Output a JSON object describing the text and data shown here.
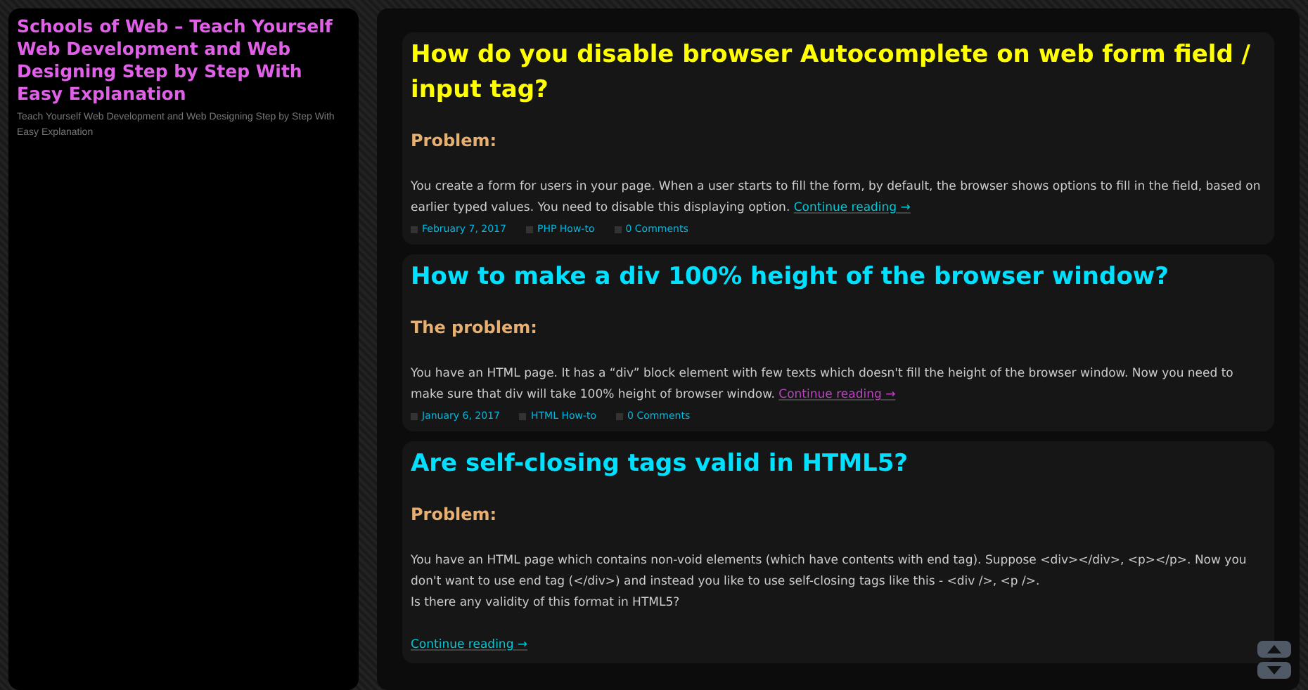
{
  "sidebar": {
    "site_title": "Schools of Web – Teach Yourself Web Development and Web Designing Step by Step With Easy Explanation",
    "tagline": "Teach Yourself Web Development and Web Designing Step by Step With Easy Explanation"
  },
  "posts": [
    {
      "title": "How do you disable browser Autocomplete on web form field / input tag?",
      "color": "#ffff00",
      "heading": "Problem:",
      "paragraphs": [
        "You create a form for users in your page.  When a user starts to fill the form, by default, the browser shows options to fill in the field, based on earlier typed values. You need to disable this displaying option."
      ],
      "continue": {
        "label": "Continue reading →",
        "color": "#00c8d8",
        "separate": false
      },
      "meta": {
        "date": "February 7, 2017",
        "category": "PHP How-to",
        "comments": "0 Comments"
      }
    },
    {
      "title": "How to make a div 100% height of the browser window?",
      "color": "#00e0ff",
      "heading": "The problem:",
      "paragraphs": [
        "You have an HTML page. It has a “div” block element with few texts which doesn't fill the height of the browser window. Now you need to make sure that div will take 100% height of browser window."
      ],
      "continue": {
        "label": "Continue reading →",
        "color": "#c040c8",
        "separate": false
      },
      "meta": {
        "date": "January 6, 2017",
        "category": "HTML How-to",
        "comments": "0 Comments"
      }
    },
    {
      "title": "Are self-closing tags valid in HTML5?",
      "color": "#00e0ff",
      "heading": "Problem:",
      "paragraphs": [
        "You have an HTML page which contains non-void elements (which have contents with end tag). Suppose <div></div>, <p></p>. Now you don't want to use end tag (</div>) and instead you like to use self-closing tags like this - <div />, <p />.",
        "Is there any validity of this format in HTML5?"
      ],
      "continue": {
        "label": "Continue reading →",
        "color": "#00c8d8",
        "separate": true
      }
    }
  ]
}
